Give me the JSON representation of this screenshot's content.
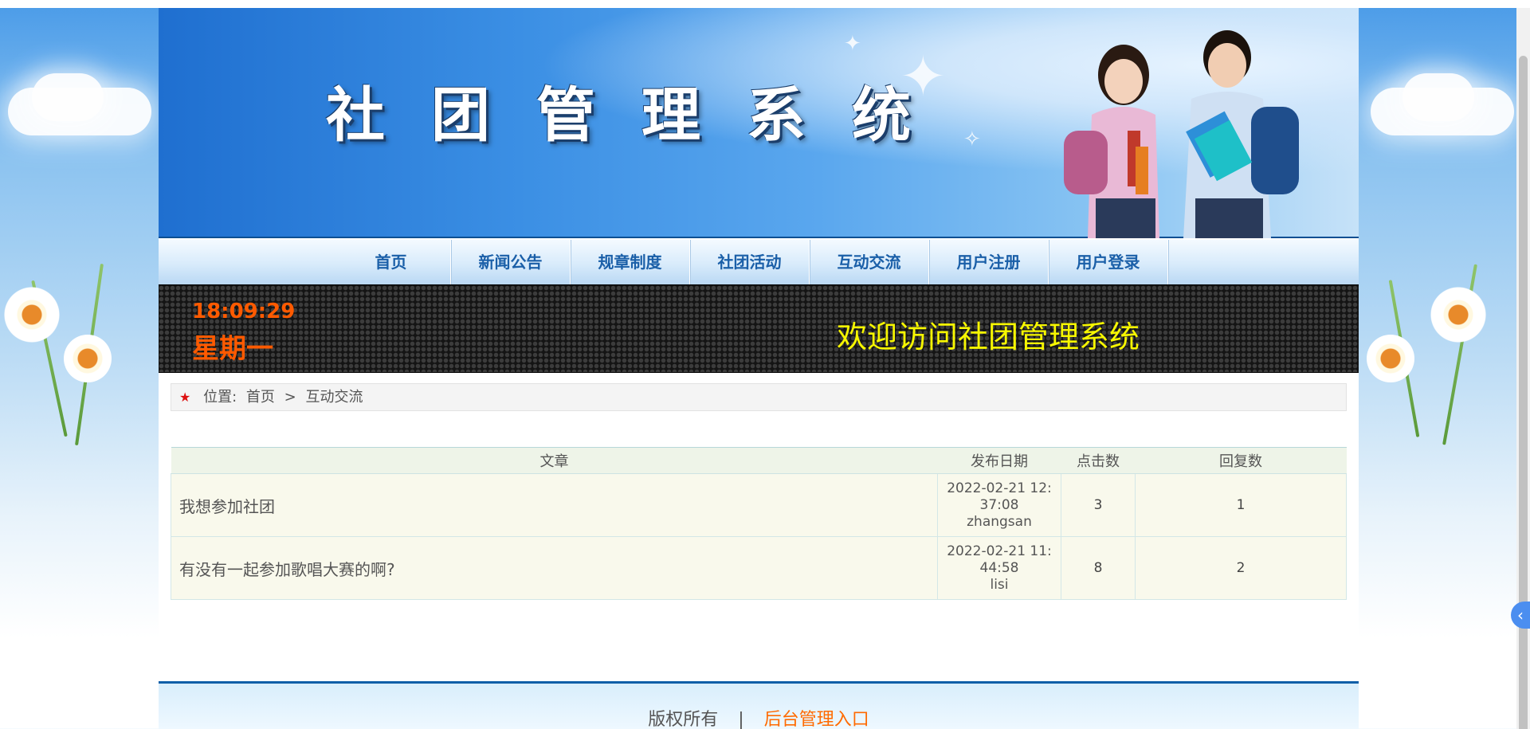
{
  "banner": {
    "title": "社团管理系统"
  },
  "nav": {
    "items": [
      {
        "label": "首页"
      },
      {
        "label": "新闻公告"
      },
      {
        "label": "规章制度"
      },
      {
        "label": "社团活动"
      },
      {
        "label": "互动交流"
      },
      {
        "label": "用户注册"
      },
      {
        "label": "用户登录"
      }
    ]
  },
  "ticker": {
    "time": "18:09:29",
    "weekday": "星期一",
    "welcome": "欢迎访问社团管理系统"
  },
  "breadcrumb": {
    "prefix": "位置:",
    "home": "首页",
    "separator": ">",
    "current": "互动交流"
  },
  "table": {
    "headers": {
      "article": "文章",
      "date": "发布日期",
      "clicks": "点击数",
      "replies": "回复数"
    },
    "rows": [
      {
        "title": "我想参加社团",
        "date_line1": "2022-02-21 12:",
        "date_line2": "37:08",
        "author": "zhangsan",
        "clicks": "3",
        "replies": "1"
      },
      {
        "title": "有没有一起参加歌唱大赛的啊?",
        "date_line1": "2022-02-21 11:",
        "date_line2": "44:58",
        "author": "lisi",
        "clicks": "8",
        "replies": "2"
      }
    ]
  },
  "footer": {
    "copyright": "版权所有",
    "separator": "|",
    "admin_link": "后台管理入口"
  },
  "colors": {
    "nav_text": "#1a5fa8",
    "clock": "#ff5a00",
    "welcome": "#f7f700",
    "footer_link": "#ff6a00",
    "accent_border": "#0e5ea8"
  }
}
